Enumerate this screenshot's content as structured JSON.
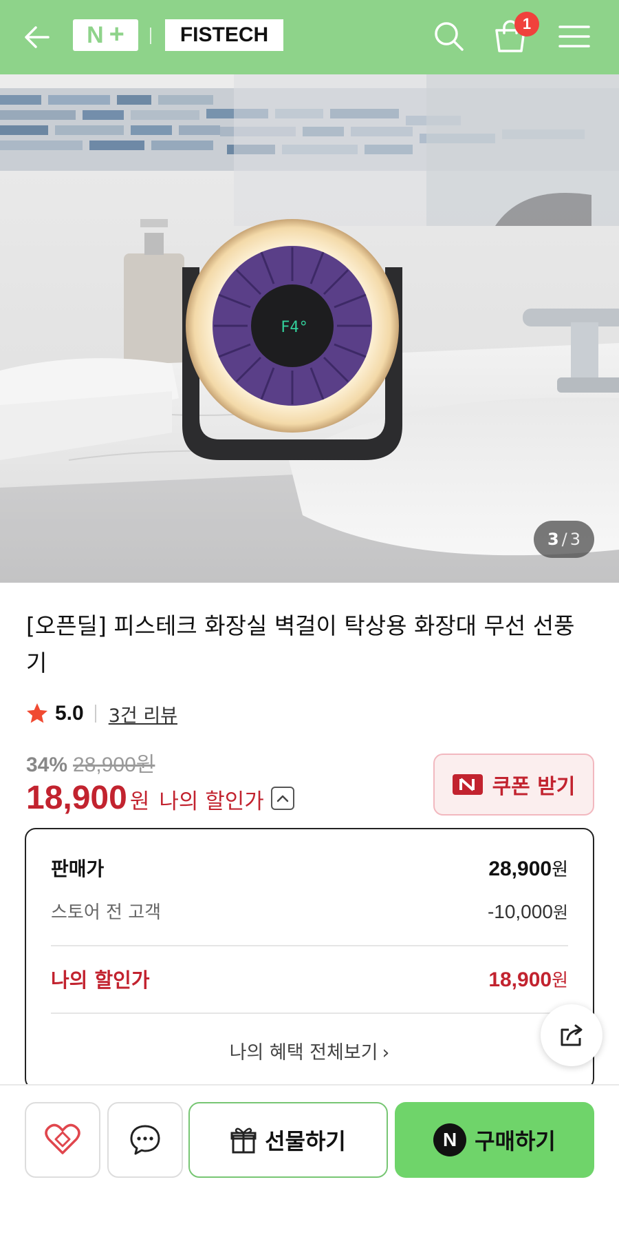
{
  "header": {
    "badge_n": "N",
    "badge_plus": "+",
    "brand": "FISTECH",
    "cart_count": "1",
    "bg_color": "#8ed38a"
  },
  "gallery": {
    "current": "3",
    "separator": "/",
    "total": "3",
    "fan_display": "F4°"
  },
  "product": {
    "title": "[오픈딜] 피스테크 화장실 벽걸이 탁상용 화장대 무선 선풍기",
    "rating": "5.0",
    "reviews": "3건 리뷰",
    "discount_rate": "34%",
    "original_price": "28,900원",
    "final_price": "18,900",
    "won": "원",
    "my_discount_label": "나의 할인가",
    "coupon_label": "쿠폰 받기"
  },
  "breakdown": {
    "sale_label": "판매가",
    "sale_amount": "28,900",
    "store_label": "스토어 전 고객",
    "store_amount": "-10,000",
    "my_label": "나의 할인가",
    "my_amount": "18,900",
    "won": "원",
    "benefits_link": "나의 혜택 전체보기",
    "benefits_chevron": "›"
  },
  "bottom": {
    "gift_label": "선물하기",
    "buy_n": "N",
    "buy_label": "구매하기"
  },
  "colors": {
    "accent_red": "#c2232f",
    "buy_green": "#6fd46a",
    "star": "#f04a32"
  }
}
